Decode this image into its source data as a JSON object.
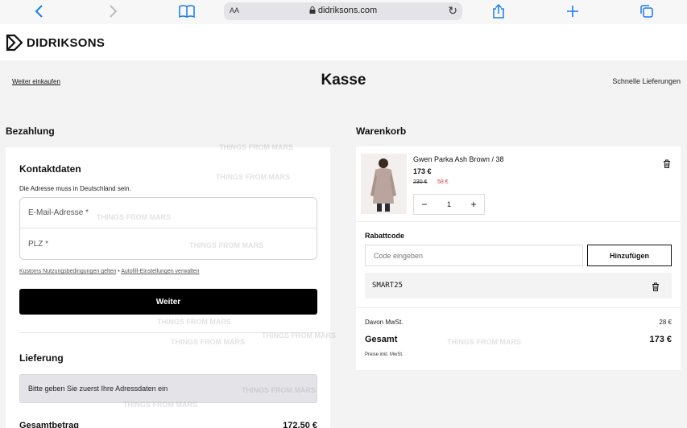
{
  "browser": {
    "address_display": "didriksons.com",
    "text_size_label": "AA"
  },
  "header": {
    "brand": "DIDRIKSONS"
  },
  "nav": {
    "back_link": "Weiter einkaufen",
    "title": "Kasse",
    "fast_delivery": "Schnelle Lieferungen"
  },
  "payment": {
    "section_title": "Bezahlung",
    "contact_title": "Kontaktdaten",
    "contact_note": "Die Adresse muss in Deutschland sein.",
    "email_placeholder": "E-Mail-Adresse *",
    "zip_placeholder": "PLZ *",
    "terms_link": "Kustoms Nutzungsbedingungen gelten",
    "separator": "•",
    "autofill_link": "Autofill-Einstellungen verwalten",
    "continue_button": "Weiter",
    "delivery_title": "Lieferung",
    "delivery_info": "Bitte geben Sie zuerst Ihre Adressdaten ein",
    "total_label": "Gesamtbetrag",
    "total_value": "172,50 €"
  },
  "cart": {
    "section_title": "Warenkorb",
    "item": {
      "name": "Gwen Parka Ash Brown / 38",
      "price": "173 €",
      "old_price": "230 €",
      "sale_price": "58 €",
      "quantity": "1"
    },
    "coupon_label": "Rabattcode",
    "coupon_placeholder": "Code eingeben",
    "coupon_button": "Hinzufügen",
    "applied_code": "SMART25",
    "tax_label": "Davon MwSt.",
    "tax_value": "28 €",
    "total_label": "Gesamt",
    "total_value": "173 €",
    "price_note": "Preise inkl. MwSt."
  },
  "watermark": "THINGS FROM MARS",
  "colors": {
    "accent": "#1a7cf0",
    "sale": "#d23a3a",
    "button_dark": "#000000"
  }
}
